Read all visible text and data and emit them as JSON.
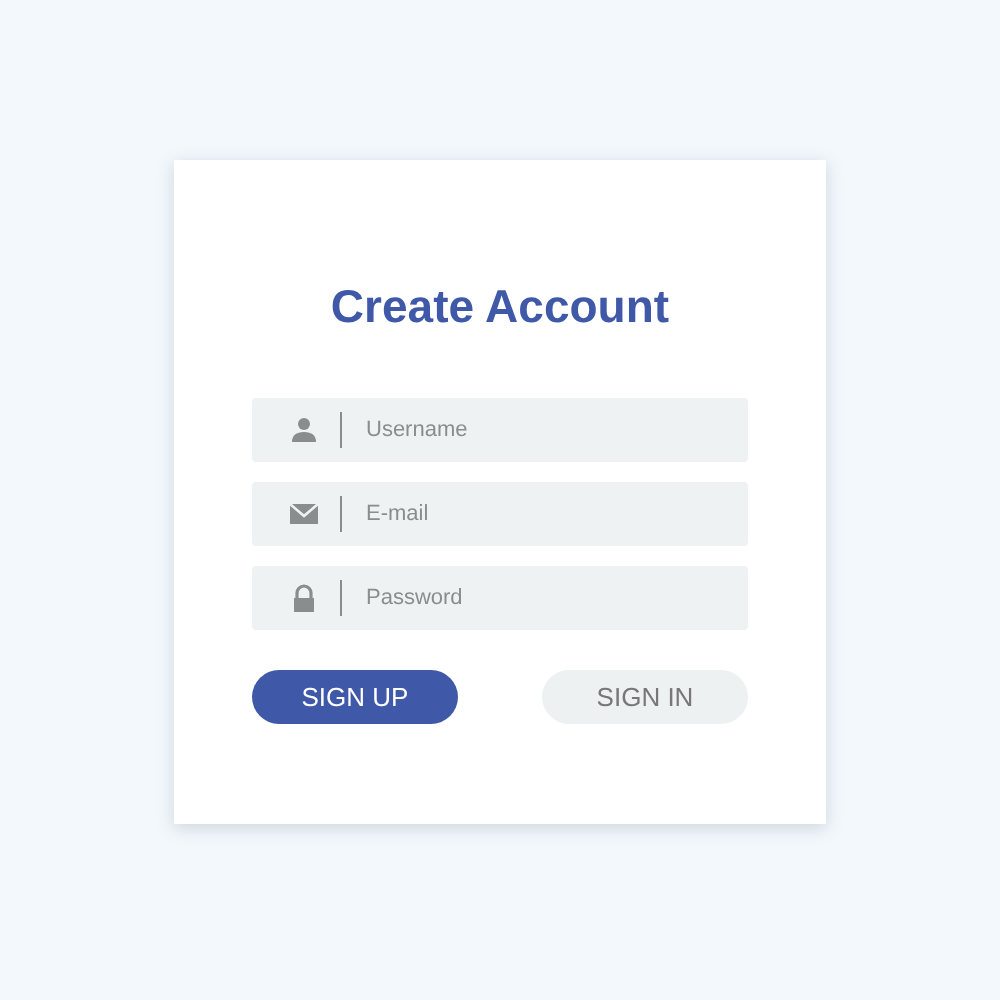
{
  "title": "Create Account",
  "fields": [
    {
      "kind": "user",
      "placeholder": "Username"
    },
    {
      "kind": "mail",
      "placeholder": "E-mail"
    },
    {
      "kind": "lock",
      "placeholder": "Password"
    }
  ],
  "buttons": [
    {
      "kind": "primary",
      "label": "SIGN UP"
    },
    {
      "kind": "secondary",
      "label": "SIGN IN"
    }
  ]
}
